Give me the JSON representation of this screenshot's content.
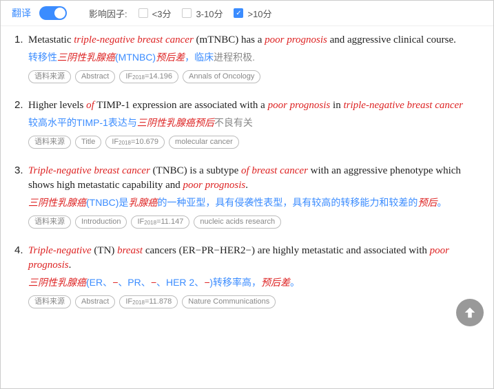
{
  "filter": {
    "translate_label": "翻译",
    "if_label": "影响因子:",
    "options": [
      {
        "label": "<3分",
        "checked": false
      },
      {
        "label": "3-10分",
        "checked": false
      },
      {
        "label": ">10分",
        "checked": true
      }
    ]
  },
  "results": [
    {
      "num": "1.",
      "en_parts": [
        {
          "t": "Metastatic ",
          "c": ""
        },
        {
          "t": "triple-negative breast cancer",
          "c": "hl-red"
        },
        {
          "t": " (mTNBC) has a ",
          "c": ""
        },
        {
          "t": "poor prognosis",
          "c": "hl-red"
        },
        {
          "t": " and aggressive clinical course.",
          "c": ""
        }
      ],
      "zh_parts": [
        {
          "t": "转移性",
          "c": ""
        },
        {
          "t": "三阴性乳腺癌",
          "c": "hl-red"
        },
        {
          "t": "(MTNBC)",
          "c": ""
        },
        {
          "t": "预后差",
          "c": "hl-red"
        },
        {
          "t": "，临床",
          "c": ""
        },
        {
          "t": "进程积极.",
          "c": "hl-gray"
        }
      ],
      "tags": {
        "source": "语料来源",
        "section": "Abstract",
        "if_year": "2018",
        "if_value": "14.196",
        "journal": "Annals of Oncology"
      }
    },
    {
      "num": "2.",
      "en_parts": [
        {
          "t": "Higher levels ",
          "c": ""
        },
        {
          "t": "of",
          "c": "hl-red"
        },
        {
          "t": " TIMP-1 expression are associated with a ",
          "c": ""
        },
        {
          "t": "poor prognosis",
          "c": "hl-red"
        },
        {
          "t": " in ",
          "c": ""
        },
        {
          "t": "triple-negative breast cancer",
          "c": "hl-red"
        }
      ],
      "zh_parts": [
        {
          "t": "较高水平的TIMP-1表达与",
          "c": ""
        },
        {
          "t": "三阴性乳腺癌预后",
          "c": "hl-red"
        },
        {
          "t": "不良有关",
          "c": "hl-gray"
        }
      ],
      "tags": {
        "source": "语料来源",
        "section": "Title",
        "if_year": "2018",
        "if_value": "10.679",
        "journal": "molecular cancer"
      }
    },
    {
      "num": "3.",
      "en_parts": [
        {
          "t": "Triple-negative breast cancer",
          "c": "hl-red"
        },
        {
          "t": " (TNBC) is a subtype ",
          "c": ""
        },
        {
          "t": "of breast cancer",
          "c": "hl-red"
        },
        {
          "t": " with an aggressive phenotype which shows high metastatic capability and ",
          "c": ""
        },
        {
          "t": "poor prognosis",
          "c": "hl-red"
        },
        {
          "t": ".",
          "c": ""
        }
      ],
      "zh_parts": [
        {
          "t": "三阴性乳腺癌",
          "c": "hl-red"
        },
        {
          "t": "(TNBC)是",
          "c": ""
        },
        {
          "t": "乳腺癌",
          "c": "hl-red"
        },
        {
          "t": "的一种亚型，具有侵袭性表型，具有较高的转移能力和较差的",
          "c": ""
        },
        {
          "t": "预后",
          "c": "hl-red"
        },
        {
          "t": "。",
          "c": ""
        }
      ],
      "tags": {
        "source": "语料来源",
        "section": "Introduction",
        "if_year": "2018",
        "if_value": "11.147",
        "journal": "nucleic acids research"
      }
    },
    {
      "num": "4.",
      "en_parts": [
        {
          "t": "Triple-negative",
          "c": "hl-red"
        },
        {
          "t": " (TN) ",
          "c": ""
        },
        {
          "t": "breast",
          "c": "hl-red"
        },
        {
          "t": " cancers (ER−PR−HER2−) are highly metastatic and associated with ",
          "c": ""
        },
        {
          "t": "poor prognosis",
          "c": "hl-red"
        },
        {
          "t": ".",
          "c": ""
        }
      ],
      "zh_parts": [
        {
          "t": "三阴性乳腺癌",
          "c": "hl-red"
        },
        {
          "t": "(ER、",
          "c": ""
        },
        {
          "t": "−",
          "c": "hl-red"
        },
        {
          "t": "、PR、",
          "c": ""
        },
        {
          "t": "−",
          "c": "hl-red"
        },
        {
          "t": "、HER 2、",
          "c": ""
        },
        {
          "t": "−",
          "c": "hl-red"
        },
        {
          "t": ")转移率高，",
          "c": ""
        },
        {
          "t": "预后差",
          "c": "hl-red"
        },
        {
          "t": "。",
          "c": ""
        }
      ],
      "tags": {
        "source": "语料来源",
        "section": "Abstract",
        "if_year": "2018",
        "if_value": "11.878",
        "journal": "Nature Communications"
      }
    }
  ]
}
